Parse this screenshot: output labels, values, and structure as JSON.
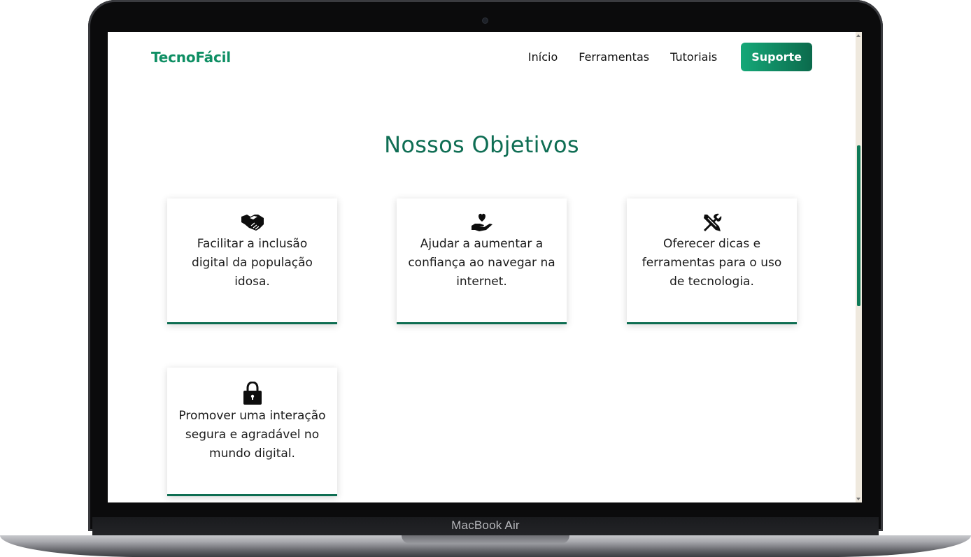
{
  "device": {
    "label": "MacBook Air"
  },
  "header": {
    "logo": "TecnoFácil",
    "nav": [
      {
        "label": "Início"
      },
      {
        "label": "Ferramentas"
      },
      {
        "label": "Tutoriais"
      }
    ],
    "support_button": "Suporte"
  },
  "objectives": {
    "title": "Nossos Objetivos",
    "cards": [
      {
        "icon": "handshake-icon",
        "text": "Facilitar a inclusão digital da população idosa."
      },
      {
        "icon": "hand-heart-icon",
        "text": "Ajudar a aumentar a confiança ao navegar na internet."
      },
      {
        "icon": "tools-icon",
        "text": "Oferecer dicas e ferramentas para o uso de tecnologia."
      },
      {
        "icon": "lock-icon",
        "text": "Promover uma interação segura e agradável no mundo digital."
      }
    ]
  },
  "colors": {
    "brand_green": "#0f8f64",
    "title_green": "#0f6e54",
    "accent_border": "#0e6e52",
    "button_gradient_start": "#15a878",
    "button_gradient_end": "#0b6a4c"
  }
}
